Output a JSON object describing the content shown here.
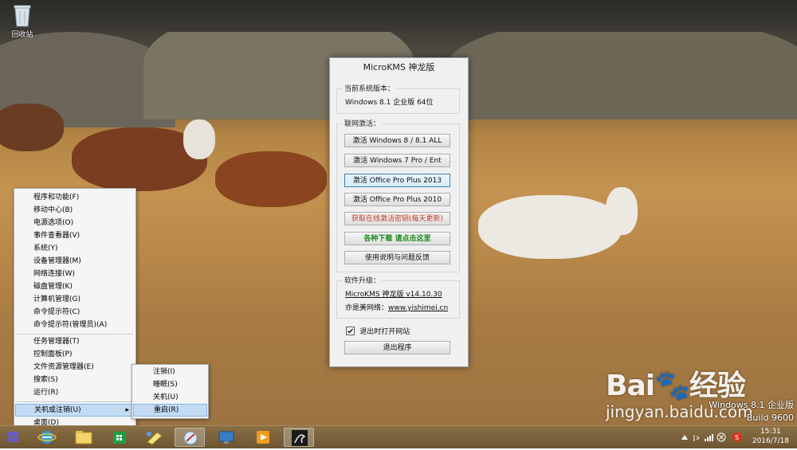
{
  "desktop": {
    "recycle_bin_label": "回收站",
    "watermark_logo": "Bai🐾经验",
    "watermark_url": "jingyan.baidu.com",
    "os_edition": "Windows 8.1 企业版",
    "os_build": "Build 9600"
  },
  "dialog": {
    "title": "MicroKMS 神龙版",
    "current_version_label": "当前系统版本：",
    "current_version_value": "Windows 8.1 企业版 64位",
    "online_activation_label": "联网激活：",
    "buttons": [
      "激活 Windows 8 / 8.1 ALL",
      "激活 Windows 7 Pro / Ent",
      "激活 Office Pro Plus 2013",
      "激活 Office Pro Plus 2010",
      "获取在线激活密钥(每天更新)",
      "各种下载 请点击这里",
      "使用说明与问题反馈"
    ],
    "upgrade_label": "软件升级：",
    "upgrade_version": "MicroKMS 神龙版 v14.10.30",
    "site_label": "亦是美网络：",
    "site_url": "www.yishimei.cn",
    "checkbox_label": "退出时打开网站",
    "checkbox_checked": true,
    "exit_button": "退出程序"
  },
  "winx_menu": {
    "items": [
      "程序和功能(F)",
      "移动中心(B)",
      "电源选项(O)",
      "事件查看器(V)",
      "系统(Y)",
      "设备管理器(M)",
      "网络连接(W)",
      "磁盘管理(K)",
      "计算机管理(G)",
      "命令提示符(C)",
      "命令提示符(管理员)(A)",
      "任务管理器(T)",
      "控制面板(P)",
      "文件资源管理器(E)",
      "搜索(S)",
      "运行(R)",
      "关机或注销(U)",
      "桌面(D)"
    ],
    "arrow": "▸"
  },
  "shutdown_submenu": {
    "items": [
      "注销(I)",
      "睡眠(S)",
      "关机(U)",
      "重启(R)"
    ]
  },
  "taskbar": {
    "icons": [
      "start-icon",
      "internet-explorer-icon",
      "file-explorer-icon",
      "store-icon",
      "paint-icon",
      "software-icon",
      "remote-desktop-icon",
      "media-player-icon",
      "microkms-icon"
    ],
    "time": "15:31",
    "date": "2016/7/18"
  },
  "colors": {
    "menu_highlight": "#c4dcf3",
    "taskbar": "#7a6039",
    "red_text": "#c0392b",
    "green_text": "#1b8a1b"
  }
}
